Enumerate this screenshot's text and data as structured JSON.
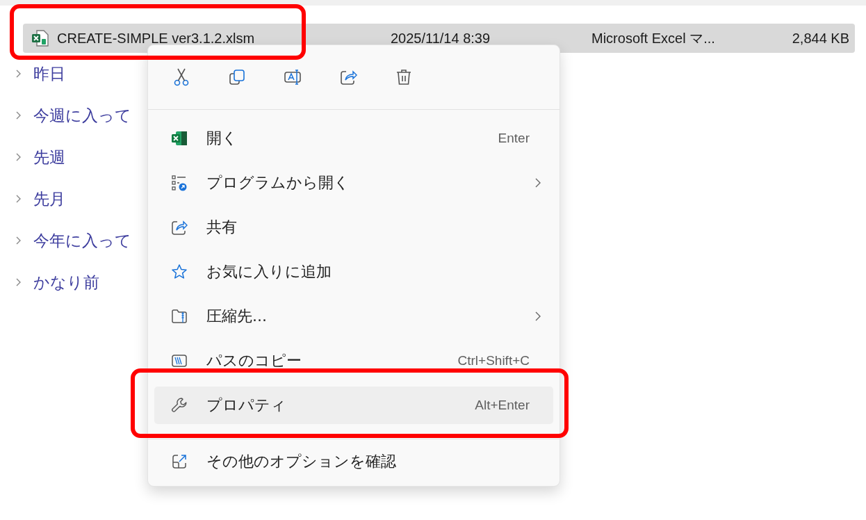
{
  "file_row": {
    "name": "CREATE-SIMPLE ver3.1.2.xlsm",
    "modified": "2025/11/14 8:39",
    "type": "Microsoft Excel マ...",
    "size": "2,844 KB",
    "selected": true
  },
  "groups": [
    {
      "label": "昨日",
      "expanded": false
    },
    {
      "label": "今週に入って",
      "expanded": false
    },
    {
      "label": "先週",
      "expanded": false
    },
    {
      "label": "先月",
      "expanded": false
    },
    {
      "label": "今年に入って",
      "expanded": false
    },
    {
      "label": "かなり前",
      "expanded": false
    }
  ],
  "context_menu": {
    "items": [
      {
        "label": "開く",
        "shortcut": "Enter",
        "submenu": false,
        "highlighted": false
      },
      {
        "label": "プログラムから開く",
        "submenu": true,
        "highlighted": false
      },
      {
        "label": "共有",
        "submenu": false,
        "highlighted": false
      },
      {
        "label": "お気に入りに追加",
        "submenu": false,
        "highlighted": false
      },
      {
        "label": "圧縮先...",
        "submenu": true,
        "highlighted": false
      },
      {
        "label": "パスのコピー",
        "shortcut": "Ctrl+Shift+C",
        "submenu": false,
        "highlighted": false
      },
      {
        "label": "プロパティ",
        "shortcut": "Alt+Enter",
        "submenu": false,
        "highlighted": true
      }
    ],
    "more_item": {
      "label": "その他のオプションを確認"
    }
  }
}
